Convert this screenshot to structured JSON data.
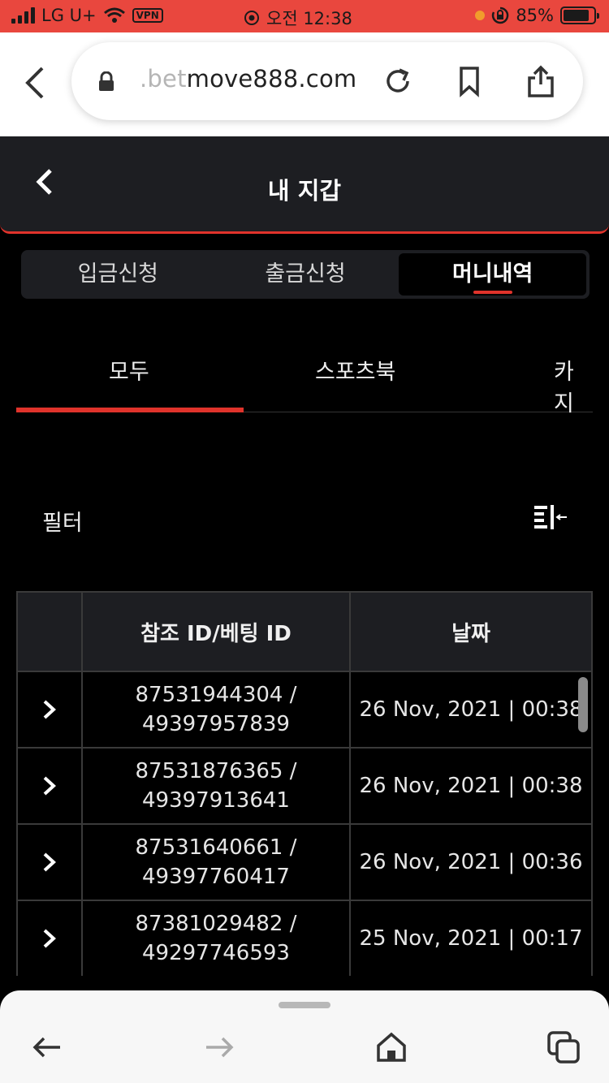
{
  "status_bar": {
    "carrier": "LG U+",
    "vpn": "VPN",
    "time": "오전 12:38",
    "battery": "85%",
    "battery_level": 0.85,
    "icons": [
      "signal-icon",
      "wifi-icon",
      "location-icon",
      "orientation-lock-icon",
      "battery-icon"
    ]
  },
  "browser": {
    "url_faded": ".bet",
    "url_main": "move888.com",
    "icons": [
      "back-icon",
      "lock-icon",
      "reload-icon",
      "bookmark-icon",
      "share-icon"
    ]
  },
  "header": {
    "title": "내 지갑"
  },
  "segment_tabs": [
    {
      "label": "입금신청",
      "active": false
    },
    {
      "label": "출금신청",
      "active": false
    },
    {
      "label": "머니내역",
      "active": true
    }
  ],
  "category_tabs": [
    {
      "label": "모두",
      "active": true
    },
    {
      "label": "스포츠북",
      "active": false
    },
    {
      "label": "카지",
      "active": false
    }
  ],
  "filter": {
    "label": "필터",
    "icon": "filter-icon"
  },
  "table": {
    "headers": [
      "",
      "참조 ID/베팅 ID",
      "날짜"
    ],
    "rows": [
      {
        "ref_id": "87531944304 /",
        "bet_id": "49397957839",
        "date": "26 Nov, 2021 | 00:38"
      },
      {
        "ref_id": "87531876365 /",
        "bet_id": "49397913641",
        "date": "26 Nov, 2021 | 00:38"
      },
      {
        "ref_id": "87531640661 /",
        "bet_id": "49397760417",
        "date": "26 Nov, 2021 | 00:36"
      },
      {
        "ref_id": "87381029482 /",
        "bet_id": "49297746593",
        "date": "25 Nov, 2021 | 00:17"
      }
    ]
  },
  "colors": {
    "status_bar": "#e9473e",
    "accent": "#e0332b",
    "header_bg": "#1d1e22",
    "page_bg": "#000000"
  },
  "bottom_toolbar": {
    "icons": [
      "back-arrow-icon",
      "forward-arrow-icon",
      "home-icon",
      "tabs-icon"
    ]
  }
}
